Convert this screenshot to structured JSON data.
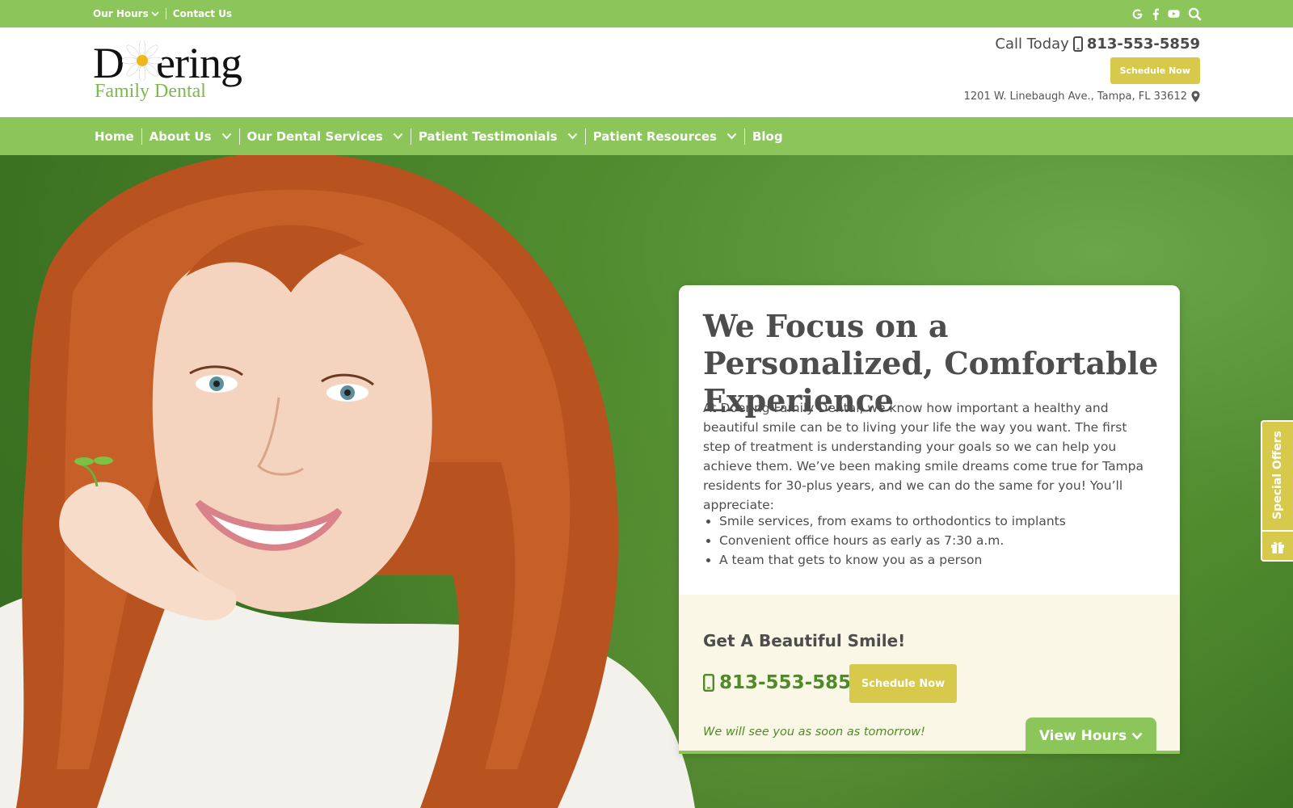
{
  "topbar": {
    "hours_label": "Our Hours",
    "contact_label": "Contact Us",
    "social_icons": [
      "google-icon",
      "facebook-icon",
      "youtube-icon",
      "search-icon"
    ]
  },
  "header": {
    "logo_word_pre": "D",
    "logo_word_post": "ering",
    "logo_sub": "Family Dental",
    "call_label": "Call Today",
    "phone": "813-553-5859",
    "schedule_label": "Schedule Now",
    "address": "1201 W. Linebaugh Ave., Tampa, FL 33612"
  },
  "nav": {
    "items": [
      {
        "label": "Home",
        "dropdown": false
      },
      {
        "label": "About Us",
        "dropdown": true
      },
      {
        "label": "Our Dental Services",
        "dropdown": true
      },
      {
        "label": "Patient Testimonials",
        "dropdown": true
      },
      {
        "label": "Patient Resources",
        "dropdown": true
      },
      {
        "label": "Blog",
        "dropdown": false
      }
    ]
  },
  "hero": {
    "heading": "We Focus on a Personalized, Comfortable Experience",
    "intro": "At Doering Family Dental, we know how important a healthy and beautiful smile can be to living your life the way you want. The first step of treatment is understanding your goals so we can help you achieve them. We’ve been making smile dreams come true for Tampa residents for 30-plus years, and we can do the same for you! You’ll appreciate:",
    "bullets": [
      "Smile services, from exams to orthodontics to implants",
      "Convenient office hours as early as 7:30 a.m.",
      "A team that gets to know you as a person"
    ],
    "cta_heading": "Get A Beautiful Smile!",
    "cta_phone": "813-553-5859",
    "cta_schedule": "Schedule Now",
    "cta_note": "We will see you as soon as tomorrow!",
    "view_hours": "View Hours"
  },
  "sidetab": {
    "label": "Special Offers"
  },
  "colors": {
    "brand_green": "#8cc65a",
    "accent_gold": "#d7c94c",
    "text_dark": "#4d4d4d",
    "link_green": "#4d8c25"
  }
}
